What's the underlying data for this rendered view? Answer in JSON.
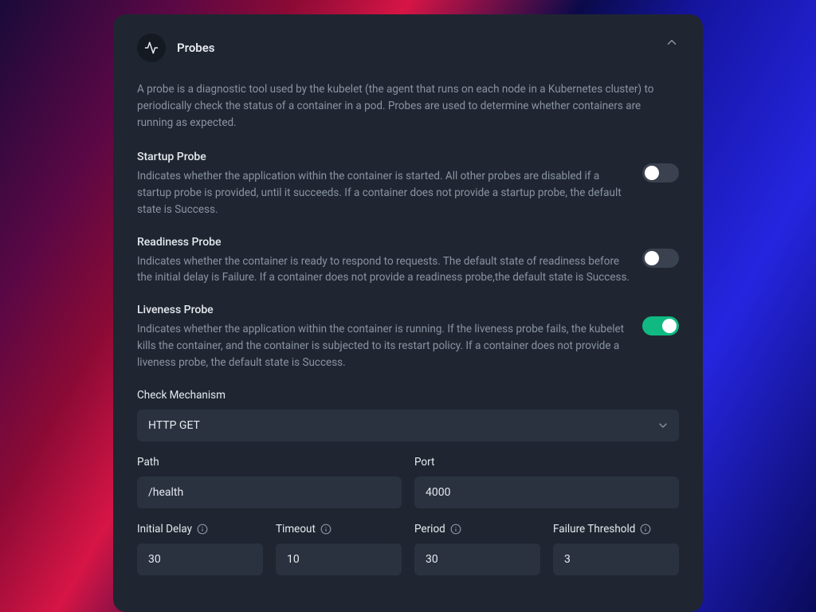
{
  "header": {
    "title": "Probes"
  },
  "description": "A probe is a diagnostic tool used by the kubelet (the agent that runs on each node in a Kubernetes cluster) to periodically check the status of a container in a pod. Probes are used to determine whether containers are running as expected.",
  "startup": {
    "title": "Startup Probe",
    "desc": "Indicates whether the application within the container is started. All other probes are disabled if a startup probe is provided, until it succeeds. If a container does not provide a startup probe, the default state is Success.",
    "enabled": false
  },
  "readiness": {
    "title": "Readiness Probe",
    "desc": "Indicates whether the container is ready to respond to requests. The default state of readiness before the initial delay is Failure. If a container does not provide a readiness probe,the default state is Success.",
    "enabled": false
  },
  "liveness": {
    "title": "Liveness Probe",
    "desc": "Indicates whether the application within the container is running. If the liveness probe fails, the kubelet kills the container, and the container is subjected to its restart policy. If a container does not provide a liveness probe, the default state is Success.",
    "enabled": true
  },
  "mechanism": {
    "label": "Check Mechanism",
    "value": "HTTP GET"
  },
  "path": {
    "label": "Path",
    "value": "/health"
  },
  "port": {
    "label": "Port",
    "value": "4000"
  },
  "initialDelay": {
    "label": "Initial Delay",
    "value": "30"
  },
  "timeout": {
    "label": "Timeout",
    "value": "10"
  },
  "period": {
    "label": "Period",
    "value": "30"
  },
  "failureThreshold": {
    "label": "Failure Threshold",
    "value": "3"
  }
}
